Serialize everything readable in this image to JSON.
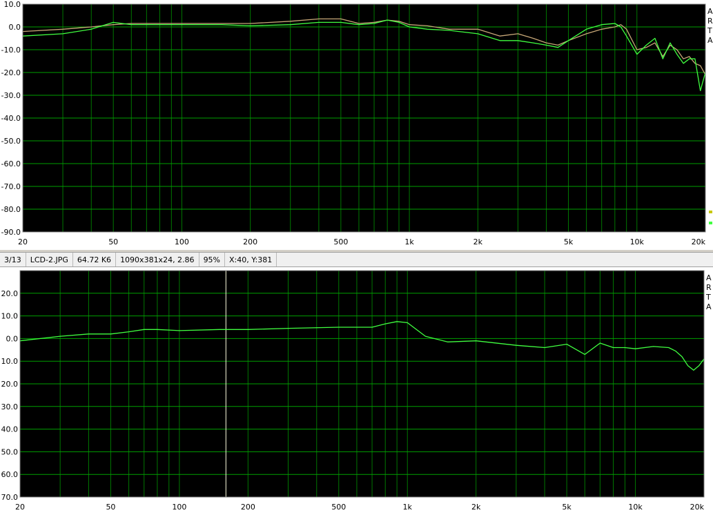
{
  "statusbar": {
    "index": "3/13",
    "filename": "LCD-2.JPG",
    "filesize": "64.72 K6",
    "dimensions": "1090x381x24, 2.86",
    "zoom": "95%",
    "cursor": "X:40, Y:381"
  },
  "colors": {
    "plot_bg": "#000000",
    "grid": "#00a000",
    "series_green": "#40ff40",
    "series_tan": "#c8a878",
    "cursor_line": "#ffffe0"
  },
  "chart_data": [
    {
      "type": "line",
      "title": "",
      "xscale": "log",
      "xlim": [
        20,
        20000
      ],
      "ylim": [
        -90,
        10
      ],
      "xticks": [
        20,
        50,
        100,
        200,
        500,
        1000,
        2000,
        5000,
        10000,
        20000
      ],
      "xtick_labels": [
        "20",
        "50",
        "100",
        "200",
        "500",
        "1k",
        "2k",
        "5k",
        "10k",
        "20k"
      ],
      "yticks": [
        10,
        0,
        -10,
        -20,
        -30,
        -40,
        -50,
        -60,
        -70,
        -80,
        -90
      ],
      "ytick_labels": [
        "10.0",
        "0.0",
        "-10.0",
        "-20.0",
        "-30.0",
        "-40.0",
        "-50.0",
        "-60.0",
        "-70.0",
        "-80.0",
        "-90.0"
      ],
      "side_labels": [
        "A",
        "R",
        "T",
        "A"
      ],
      "grid": true,
      "series": [
        {
          "color": "#c8a878",
          "x": [
            20,
            30,
            40,
            50,
            60,
            80,
            100,
            150,
            200,
            300,
            400,
            500,
            600,
            700,
            800,
            900,
            1000,
            1200,
            1500,
            2000,
            2500,
            3000,
            3500,
            4000,
            4500,
            5000,
            6000,
            7000,
            8000,
            8500,
            9000,
            10000,
            11000,
            12000,
            13000,
            14000,
            15000,
            16000,
            17000,
            18000,
            19000,
            20000
          ],
          "y": [
            -2,
            -1,
            0,
            1,
            1.5,
            1.5,
            1.5,
            1.5,
            1.5,
            2.5,
            3.5,
            3.5,
            1.5,
            2,
            3,
            2.5,
            1,
            0.5,
            -1,
            -1,
            -4,
            -3,
            -5,
            -7,
            -8,
            -6,
            -3,
            -1,
            0,
            1,
            -1,
            -10,
            -9,
            -7,
            -13,
            -8,
            -10,
            -14,
            -13,
            -16,
            -17,
            -21
          ]
        },
        {
          "color": "#40ff40",
          "x": [
            20,
            30,
            40,
            50,
            60,
            80,
            100,
            150,
            200,
            300,
            400,
            500,
            600,
            700,
            800,
            900,
            1000,
            1200,
            1500,
            2000,
            2500,
            3000,
            3500,
            4000,
            4500,
            5000,
            6000,
            7000,
            8000,
            8500,
            9000,
            10000,
            11000,
            12000,
            13000,
            14000,
            15000,
            16000,
            17000,
            18000,
            19000,
            20000
          ],
          "y": [
            -4,
            -3,
            -1,
            2,
            1,
            1,
            1,
            1,
            0.5,
            1,
            2,
            2,
            1,
            1.5,
            3,
            2,
            0,
            -1,
            -1.5,
            -3,
            -6,
            -6,
            -7,
            -8,
            -9,
            -6,
            -1,
            1,
            1.5,
            0,
            -4,
            -12,
            -8,
            -5,
            -14,
            -7,
            -12,
            -16,
            -14,
            -14,
            -28,
            -20
          ]
        }
      ]
    },
    {
      "type": "line",
      "title": "",
      "xscale": "log",
      "xlim": [
        20,
        20000
      ],
      "ylim": [
        -70,
        30
      ],
      "xticks": [
        20,
        50,
        100,
        200,
        500,
        1000,
        2000,
        5000,
        10000,
        20000
      ],
      "xtick_labels": [
        "20",
        "50",
        "100",
        "200",
        "500",
        "1k",
        "2k",
        "5k",
        "10k",
        "20k"
      ],
      "yticks": [
        20,
        10,
        0,
        -10,
        -20,
        -30,
        -40,
        -50,
        -60,
        -70
      ],
      "ytick_labels": [
        "20.0",
        "10.0",
        "0.0",
        "10.0",
        "20.0",
        "30.0",
        "40.0",
        "50.0",
        "60.0",
        "70.0"
      ],
      "side_labels": [
        "A",
        "R",
        "T",
        "A"
      ],
      "grid": true,
      "cursor_x": 160,
      "series": [
        {
          "color": "#40ff40",
          "x": [
            20,
            30,
            40,
            50,
            60,
            70,
            80,
            100,
            150,
            200,
            300,
            500,
            700,
            800,
            900,
            1000,
            1200,
            1500,
            2000,
            3000,
            4000,
            5000,
            6000,
            7000,
            8000,
            9000,
            10000,
            12000,
            14000,
            15000,
            16000,
            17000,
            18000,
            19000,
            20000
          ],
          "y": [
            -1,
            1,
            2,
            2,
            3,
            4,
            4,
            3.5,
            4,
            4,
            4.5,
            5,
            5,
            6.5,
            7.5,
            7,
            1,
            -1.5,
            -1,
            -3,
            -4,
            -2.5,
            -7,
            -2,
            -4,
            -4,
            -4.5,
            -3.5,
            -4,
            -5.5,
            -8,
            -12,
            -14,
            -12,
            -9
          ]
        }
      ]
    }
  ]
}
